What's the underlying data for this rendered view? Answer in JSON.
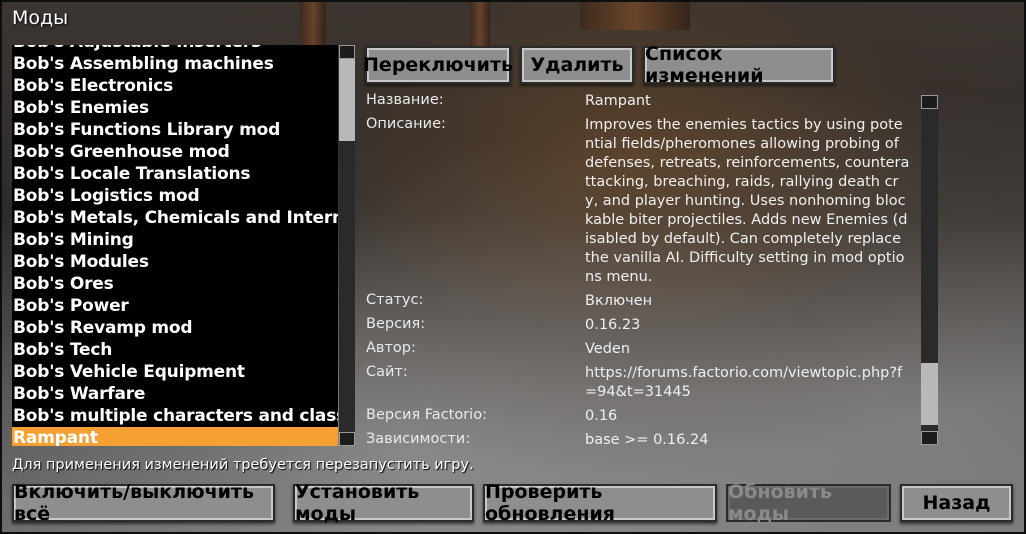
{
  "window": {
    "title": "Моды"
  },
  "mods": [
    {
      "name": "Bob's Adjustable Inserters",
      "selected": false,
      "partial": true
    },
    {
      "name": "Bob's Assembling machines",
      "selected": false
    },
    {
      "name": "Bob's Electronics",
      "selected": false
    },
    {
      "name": "Bob's Enemies",
      "selected": false
    },
    {
      "name": "Bob's Functions Library mod",
      "selected": false
    },
    {
      "name": "Bob's Greenhouse mod",
      "selected": false
    },
    {
      "name": "Bob's Locale Translations",
      "selected": false
    },
    {
      "name": "Bob's Logistics mod",
      "selected": false
    },
    {
      "name": "Bob's Metals, Chemicals and Intermediates",
      "selected": false
    },
    {
      "name": "Bob's Mining",
      "selected": false
    },
    {
      "name": "Bob's Modules",
      "selected": false
    },
    {
      "name": "Bob's Ores",
      "selected": false
    },
    {
      "name": "Bob's Power",
      "selected": false
    },
    {
      "name": "Bob's Revamp mod",
      "selected": false
    },
    {
      "name": "Bob's Tech",
      "selected": false
    },
    {
      "name": "Bob's Vehicle Equipment",
      "selected": false
    },
    {
      "name": "Bob's Warfare",
      "selected": false
    },
    {
      "name": "Bob's multiple characters and classes",
      "selected": false
    },
    {
      "name": "Rampant",
      "selected": true
    }
  ],
  "actions": {
    "toggle": "Переключить",
    "delete": "Удалить",
    "changelog": "Список изменений"
  },
  "details": [
    {
      "label": "Название:",
      "value": "Rampant"
    },
    {
      "label": "Описание:",
      "value": "Improves the enemies tactics by using potential fields/pheromones allowing probing of defenses, retreats, reinforcements, counterattacking, breaching, raids, rallying death cry, and player hunting. Uses nonhoming blockable biter projectiles. Adds new Enemies (disabled by default). Can completely replace the vanilla AI. Difficulty setting in mod options menu."
    },
    {
      "label": "Статус:",
      "value": "Включен"
    },
    {
      "label": "Версия:",
      "value": "0.16.23"
    },
    {
      "label": "Автор:",
      "value": "Veden"
    },
    {
      "label": "Сайт:",
      "value": "https://forums.factorio.com/viewtopic.php?f=94&t=31445"
    },
    {
      "label": "Версия Factorio:",
      "value": "0.16"
    },
    {
      "label": "Зависимости:",
      "value": "base >= 0.16.24"
    }
  ],
  "hint": "Для применения изменений требуется перезапустить игру.",
  "footer": {
    "toggle_all": "Включить/выключить всё",
    "install": "Установить моды",
    "check_updates": "Проверить обновления",
    "update": "Обновить моды",
    "back": "Назад"
  },
  "colors": {
    "selected": "#f5a033",
    "list_bg": "#000000",
    "button": "#8e8e8e"
  },
  "icons": [
    "scroll-up-arrow-icon",
    "scroll-down-arrow-icon"
  ]
}
